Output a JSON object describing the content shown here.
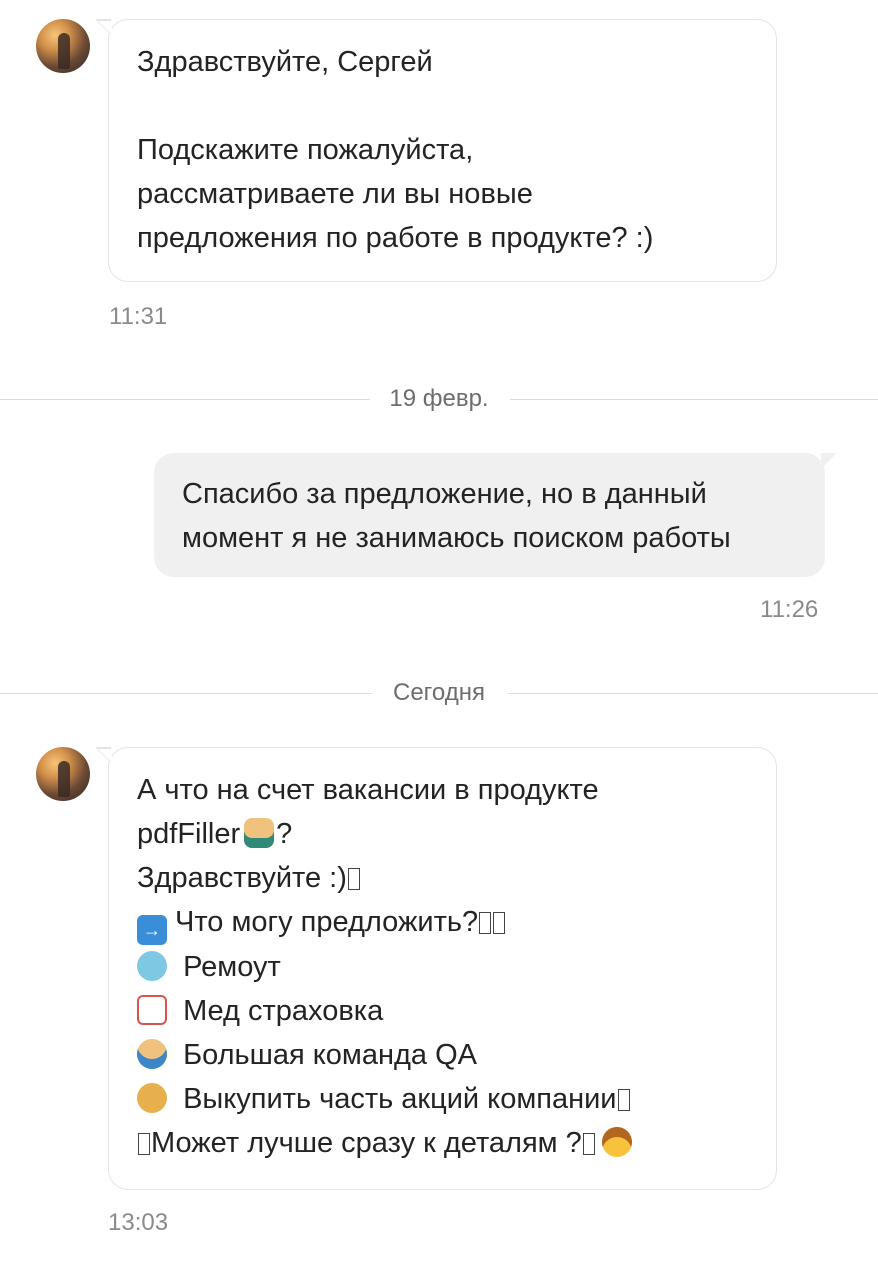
{
  "messages": [
    {
      "lines": [
        "Здравствуйте, Сергей",
        "",
        "Подскажите пожалуйста,",
        "рассматриваете ли вы новые",
        "предложения по работе в продукте? :)"
      ],
      "time": "11:31"
    },
    {
      "date_divider": "19 февр.",
      "lines": [
        "Спасибо за предложение, но в данный",
        "момент я не занимаюсь поиском работы"
      ],
      "time": "11:26"
    },
    {
      "date_divider": "Сегодня",
      "lines": [
        "А что на счет вакансии в продукте",
        "pdfFiller",
        "?",
        "Здравствуйте :)",
        "Что могу предложить?",
        "Ремоут",
        "Мед страховка",
        "Большая команда QA",
        "Выкупить часть акций компании",
        "Может лучше сразу к деталям ?"
      ],
      "time": "13:03"
    }
  ],
  "icons": {
    "laptop": "technologist-emoji-icon",
    "soon": "soon-arrow-icon",
    "island": "desert-island-icon",
    "ambulance": "ambulance-icon",
    "shrug": "person-shrugging-icon",
    "moneybag": "money-bag-icon",
    "cowboy": "cowboy-face-icon",
    "missing": "missing-glyph-icon"
  }
}
